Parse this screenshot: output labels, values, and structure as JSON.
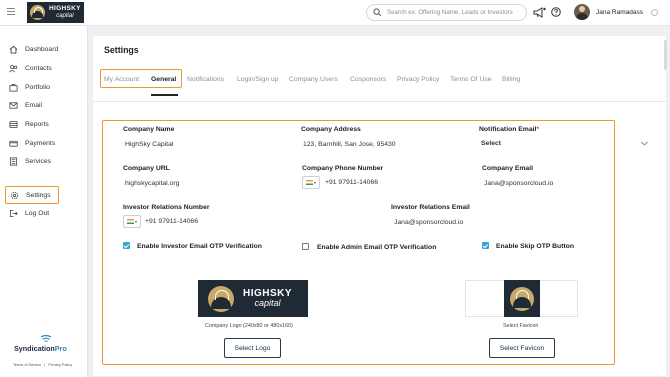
{
  "header": {
    "logo": {
      "line1": "HIGHSKY",
      "line2": "capital"
    },
    "search_placeholder": "Search ex. Offering Name, Leads or Investors",
    "user_name": "Jana Ramadass",
    "icons": [
      "megaphone-icon",
      "help-icon",
      "chevron-down-icon"
    ]
  },
  "sidebar": {
    "items": [
      {
        "label": "Dashboard",
        "icon": "home-icon"
      },
      {
        "label": "Contacts",
        "icon": "contacts-icon"
      },
      {
        "label": "Portfolio",
        "icon": "briefcase-icon"
      },
      {
        "label": "Email",
        "icon": "email-icon"
      },
      {
        "label": "Reports",
        "icon": "reports-icon"
      },
      {
        "label": "Payments",
        "icon": "payments-icon"
      },
      {
        "label": "Services",
        "icon": "services-icon"
      },
      {
        "label": "Settings",
        "icon": "gear-icon",
        "active": true
      },
      {
        "label": "Log Out",
        "icon": "logout-icon"
      }
    ],
    "brand": {
      "main": "Syndication",
      "accent": "Pro"
    },
    "footer_links": [
      "Terms of Service",
      "Privacy Policy"
    ],
    "footer_separator": "|"
  },
  "main": {
    "title": "Settings",
    "tabs": [
      {
        "label": "My Account"
      },
      {
        "label": "General",
        "active": true
      },
      {
        "label": "Notifications"
      },
      {
        "label": "Login/Sign up"
      },
      {
        "label": "Company Users"
      },
      {
        "label": "Cosponsors"
      },
      {
        "label": "Privacy Policy"
      },
      {
        "label": "Terms Of Use"
      },
      {
        "label": "Billing"
      }
    ],
    "form": {
      "company_name": {
        "label": "Company Name",
        "value": "HighSky Capital"
      },
      "company_address": {
        "label": "Company Address",
        "value": "123, Barnhill, San Jose, 95430"
      },
      "notification_email": {
        "label": "Notification Email",
        "required_mark": "*",
        "value": "Select"
      },
      "company_url": {
        "label": "Company URL",
        "value": "highskycapital.org"
      },
      "company_phone": {
        "label": "Company Phone Number",
        "value": "+91 97911-14066"
      },
      "company_email": {
        "label": "Company Email",
        "value": "Jana@sponsorcloud.io"
      },
      "ir_number": {
        "label": "Investor Relations Number",
        "value": "+91 97911-14066"
      },
      "ir_email": {
        "label": "Investor Relations Email",
        "value": "Jana@sponsorcloud.io"
      },
      "checkboxes": [
        {
          "label": "Enable Investor Email OTP Verification",
          "checked": true
        },
        {
          "label": "Enable Admin Email OTP Verification",
          "checked": false
        },
        {
          "label": "Enable Skip OTP Button",
          "checked": true
        }
      ],
      "logo": {
        "text_line1": "HIGHSKY",
        "text_line2": "capital",
        "caption": "Company Logo (240x80 or 480x160)",
        "button": "Select Logo"
      },
      "favicon": {
        "caption": "Select Favicon",
        "button": "Select Favicon"
      }
    }
  },
  "colors": {
    "highlight": "#f0962f",
    "checkbox": "#35a3d6",
    "brand_dark": "#1f2a35",
    "brand_gold": "#c9a968"
  }
}
